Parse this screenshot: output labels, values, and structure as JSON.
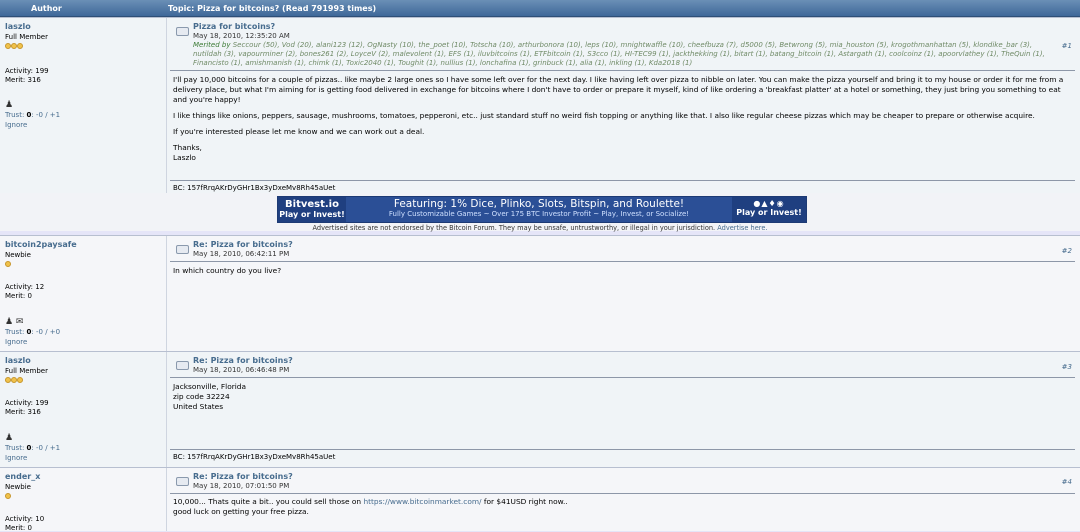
{
  "header": {
    "author_label": "Author",
    "topic_label": "Topic: Pizza for bitcoins?  (Read 791993 times)"
  },
  "posts": [
    {
      "username": "laszlo",
      "rank": "Full Member",
      "activity": "Activity: 199",
      "merit": "Merit: 316",
      "trust_label": "Trust:",
      "trust_value": "0",
      "trust_rest": ": -0 / +1",
      "ignore": "Ignore",
      "title": "Pizza for bitcoins?",
      "date": "May 18, 2010, 12:35:20 AM",
      "number": "#1",
      "merited_prefix": "Merited by",
      "merited_list": "Seccour (50), Vod (20), alani123 (12), OgNasty (10), the_poet (10), Totscha (10), arthurbonora (10), leps (10), mnightwaffle (10), cheefbuza (7), d5000 (5), Betwrong (5), mia_houston (5), krogothmanhattan (5), klondike_bar (3), nutildah (3), vapourminer (2), bones261 (2), LoyceV (2), malevolent (1), EFS (1), iluvbitcoins (1), ETFbitcoin (1), S3cco (1), HI-TEC99 (1), jackthekking (1), bitart (1), batang_bitcoin (1), Astargath (1), coolcoinz (1), apoorvlathey (1), TheQuin (1), Financisto (1), amishmanish (1), chimk (1), Toxic2040 (1), Toughit (1), nullius (1), lonchafina (1), grinbuck (1), alia (1), inkling (1), Kda2018 (1)",
      "body": [
        "I'll pay 10,000 bitcoins for a couple of pizzas.. like maybe 2 large ones so I have some left over for the next day.  I like having left over pizza to nibble on later.  You can make the pizza yourself and bring it to my house or order it for me from a delivery place, but what I'm aiming for is getting food delivered in exchange for bitcoins where I don't have to order or prepare it myself, kind of like ordering a 'breakfast platter' at a hotel or something, they just bring you something to eat and you're happy!",
        "I like things like onions, peppers, sausage, mushrooms, tomatoes, pepperoni, etc.. just standard stuff no weird fish topping or anything like that.  I also like regular cheese pizzas which may be cheaper to prepare or otherwise acquire.",
        "If you're interested please let me know and we can work out a deal.",
        "Thanks,",
        "Laszlo"
      ],
      "signature": "BC: 157fRrqAKrDyGHr1Bx3yDxeMv8Rh45aUet"
    },
    {
      "username": "bitcoin2paysafe",
      "rank": "Newbie",
      "activity": "Activity: 12",
      "merit": "Merit: 0",
      "trust_label": "Trust:",
      "trust_value": "0",
      "trust_rest": ": -0 / +0",
      "ignore": "Ignore",
      "title": "Re: Pizza for bitcoins?",
      "date": "May 18, 2010, 06:42:11 PM",
      "number": "#2",
      "body": [
        "In which country do you live?"
      ]
    },
    {
      "username": "laszlo",
      "rank": "Full Member",
      "activity": "Activity: 199",
      "merit": "Merit: 316",
      "trust_label": "Trust:",
      "trust_value": "0",
      "trust_rest": ": -0 / +1",
      "ignore": "Ignore",
      "title": "Re: Pizza for bitcoins?",
      "date": "May 18, 2010, 06:46:48 PM",
      "number": "#3",
      "body": [
        "Jacksonville, Florida",
        "zip code 32224",
        "United States"
      ],
      "signature": "BC: 157fRrqAKrDyGHr1Bx3yDxeMv8Rh45aUet"
    },
    {
      "username": "ender_x",
      "rank": "Newbie",
      "activity": "Activity: 10",
      "merit": "Merit: 0",
      "title": "Re: Pizza for bitcoins?",
      "date": "May 18, 2010, 07:01:50 PM",
      "number": "#4",
      "body_pre": "10,000... Thats quite a bit.. you could sell those on ",
      "body_link": "https://www.bitcoinmarket.com/",
      "body_post": " for $41USD right now..",
      "body_line2": "good luck on getting your free pizza."
    }
  ],
  "ad": {
    "brand": "Bitvest.io",
    "cta": "Play or Invest!",
    "headline": "Featuring: 1% Dice, Plinko, Slots, Bitspin, and Roulette!",
    "subline": "Fully Customizable Games  ~  Over 175 BTC Investor Profit  ~  Play, Invest, or Socialize!",
    "right_cta": "Play or Invest!",
    "disclaimer": "Advertised sites are not endorsed by the Bitcoin Forum. They may be unsafe, untrustworthy, or illegal in your jurisdiction.",
    "advertise_link": "Advertise here."
  },
  "colors": {
    "header_bg": "#4a74a4",
    "link": "#476c8e",
    "banner": "#2b4f96",
    "post_bg": "#f0f4f7"
  }
}
